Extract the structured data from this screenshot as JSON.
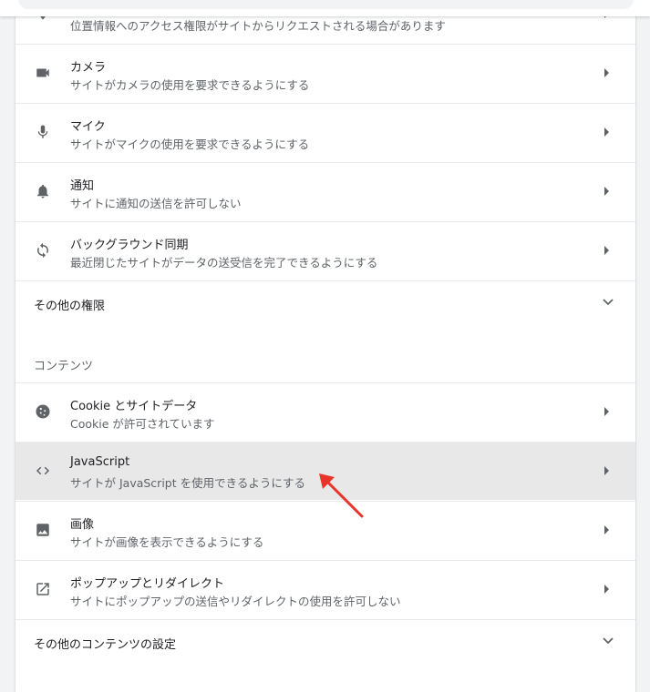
{
  "colors": {
    "annotation_arrow": "#e8352b",
    "highlight_row": "#e8e8e8",
    "icon": "#5f6368"
  },
  "rows_top": [
    {
      "icon": "location-icon",
      "secondary": "位置情報へのアクセス権限がサイトからリクエストされる場合があります"
    },
    {
      "icon": "camera-icon",
      "primary": "カメラ",
      "secondary": "サイトがカメラの使用を要求できるようにする"
    },
    {
      "icon": "microphone-icon",
      "primary": "マイク",
      "secondary": "サイトがマイクの使用を要求できるようにする"
    },
    {
      "icon": "bell-icon",
      "primary": "通知",
      "secondary": "サイトに通知の送信を許可しない"
    },
    {
      "icon": "sync-icon",
      "primary": "バックグラウンド同期",
      "secondary": "最近閉じたサイトがデータの送受信を完了できるようにする"
    }
  ],
  "more_permissions": {
    "label": "その他の権限"
  },
  "content_section": {
    "title": "コンテンツ"
  },
  "rows_content": [
    {
      "icon": "cookie-icon",
      "primary": "Cookie とサイトデータ",
      "secondary": "Cookie が許可されています"
    },
    {
      "icon": "code-icon",
      "primary": "JavaScript",
      "secondary": "サイトが JavaScript を使用できるようにする"
    },
    {
      "icon": "image-icon",
      "primary": "画像",
      "secondary": "サイトが画像を表示できるようにする"
    },
    {
      "icon": "external-link-icon",
      "primary": "ポップアップとリダイレクト",
      "secondary": "サイトにポップアップの送信やリダイレクトの使用を許可しない"
    }
  ],
  "more_content": {
    "label": "その他のコンテンツの設定"
  }
}
